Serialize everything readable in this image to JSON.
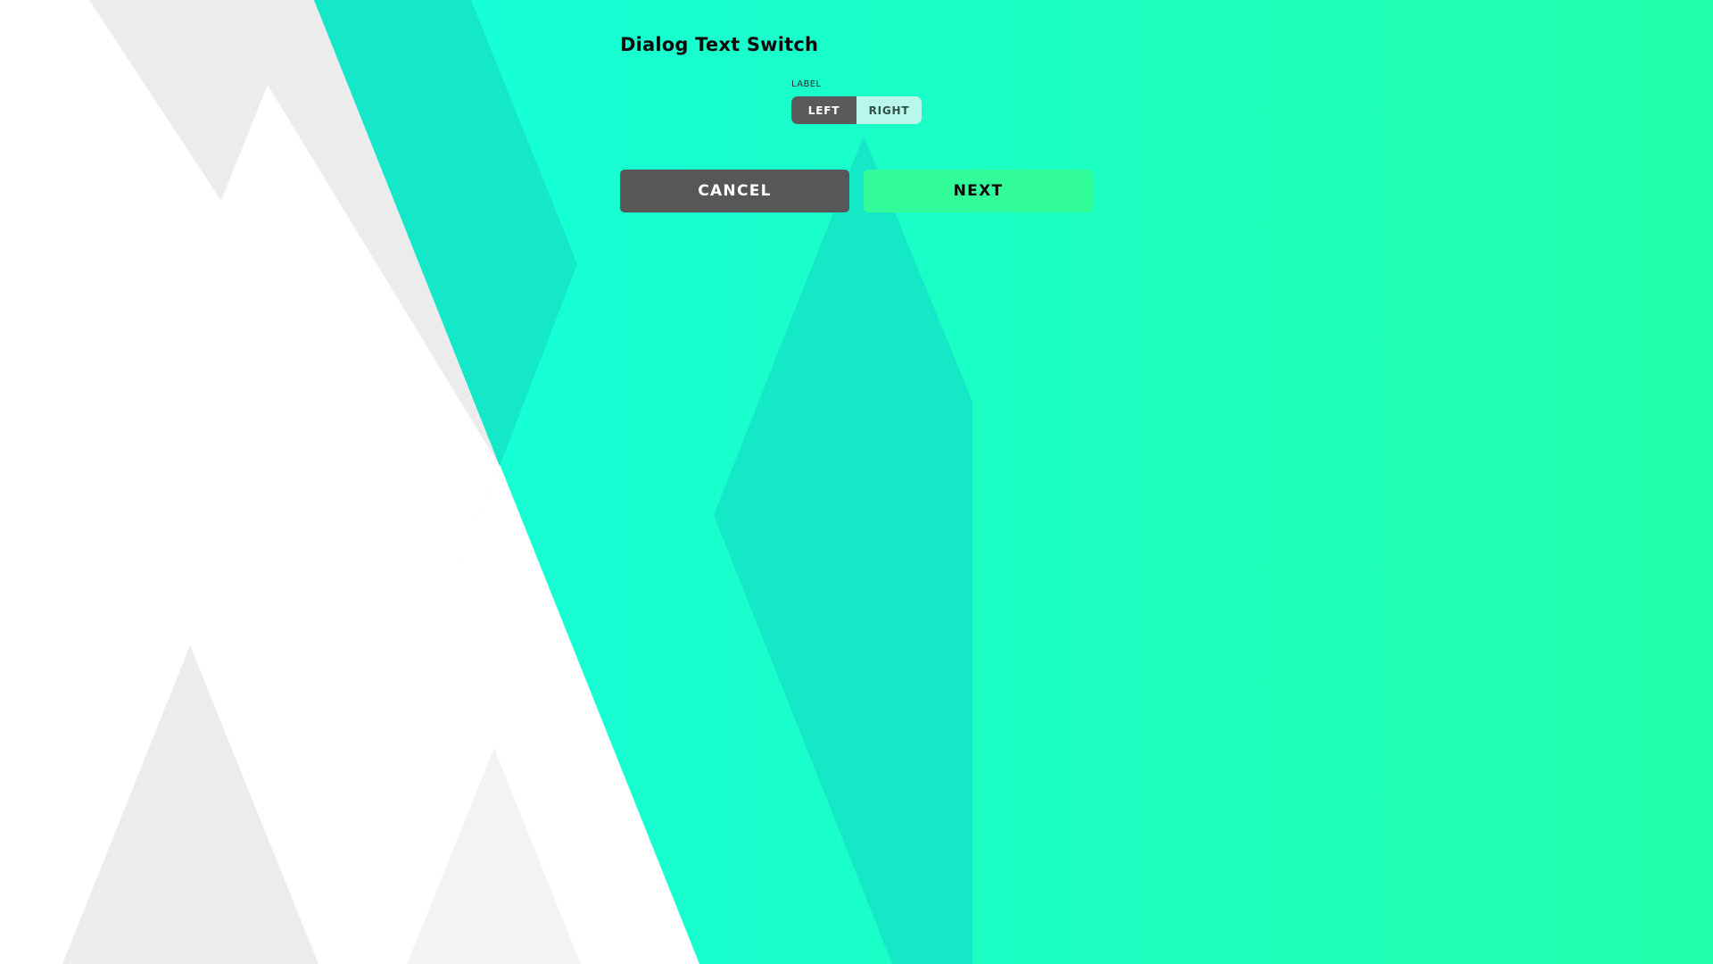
{
  "dialog": {
    "title": "Dialog Text Switch"
  },
  "text_switch": {
    "label": "LABEL",
    "options": [
      "LEFT",
      "RIGHT"
    ],
    "selected": "LEFT"
  },
  "actions": {
    "cancel_label": "CANCEL",
    "next_label": "NEXT"
  },
  "colors": {
    "background_gradient_start": "#14ffdc",
    "background_gradient_end": "#22ffab",
    "switch_active": "#5a5a5a",
    "switch_inactive": "#b9f7ea",
    "cancel_button": "#575757",
    "next_button": "#32fb9a"
  }
}
